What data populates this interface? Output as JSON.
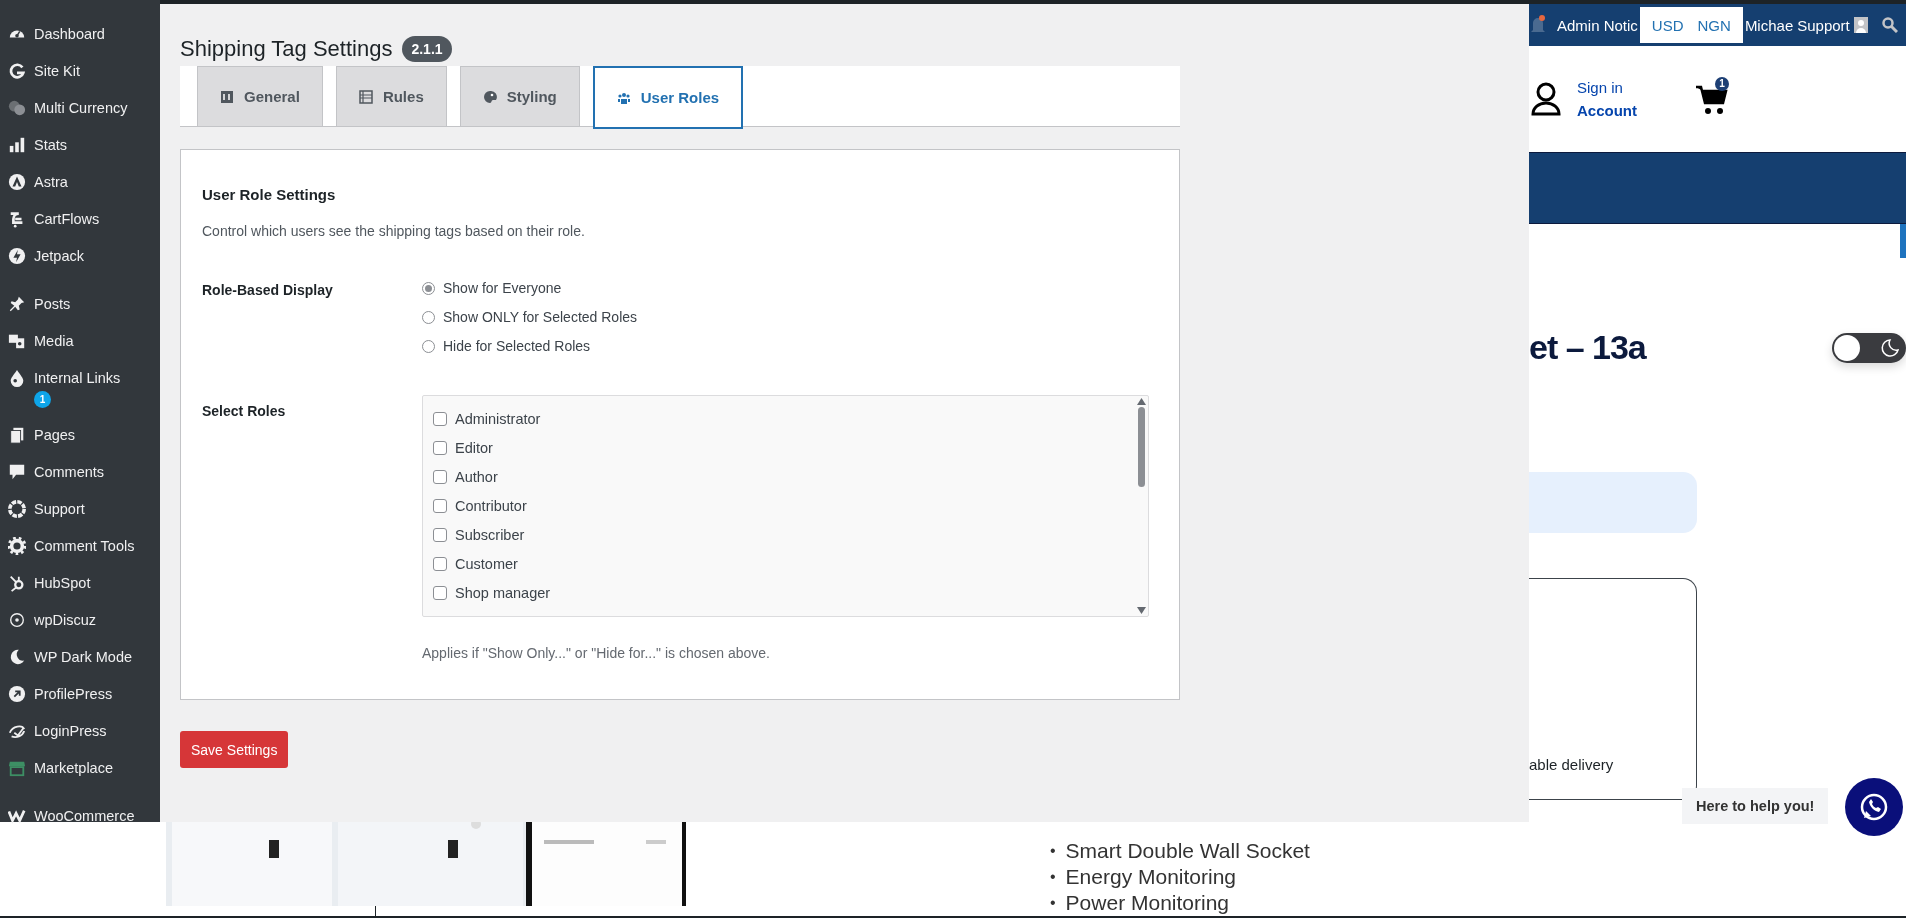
{
  "sidebar": {
    "groups": [
      [
        {
          "label": "Dashboard"
        },
        {
          "label": "Site Kit"
        },
        {
          "label": "Multi Currency"
        },
        {
          "label": "Stats"
        },
        {
          "label": "Astra"
        },
        {
          "label": "CartFlows"
        },
        {
          "label": "Jetpack"
        }
      ],
      [
        {
          "label": "Posts"
        },
        {
          "label": "Media"
        },
        {
          "label": "Internal Links",
          "badge": "1"
        },
        {
          "label": "Pages"
        },
        {
          "label": "Comments"
        },
        {
          "label": "Support"
        },
        {
          "label": "Comment Tools"
        },
        {
          "label": "HubSpot"
        },
        {
          "label": "wpDiscuz"
        },
        {
          "label": "WP Dark Mode"
        },
        {
          "label": "ProfilePress"
        },
        {
          "label": "LoginPress"
        },
        {
          "label": "Marketplace"
        }
      ],
      [
        {
          "label": "WooCommerce"
        }
      ]
    ]
  },
  "settings": {
    "title": "Shipping Tag Settings",
    "version": "2.1.1",
    "tabs": [
      {
        "label": "General",
        "selected": false
      },
      {
        "label": "Rules",
        "selected": false
      },
      {
        "label": "Styling",
        "selected": false
      },
      {
        "label": "User Roles",
        "selected": true
      }
    ],
    "section": {
      "title": "User Role Settings",
      "description": "Control which users see the shipping tags based on their role.",
      "role_display": {
        "label": "Role-Based Display",
        "options": [
          {
            "label": "Show for Everyone",
            "selected": true
          },
          {
            "label": "Show ONLY for Selected Roles",
            "selected": false
          },
          {
            "label": "Hide for Selected Roles",
            "selected": false
          }
        ]
      },
      "select_roles": {
        "label": "Select Roles",
        "roles": [
          {
            "label": "Administrator",
            "checked": false
          },
          {
            "label": "Editor",
            "checked": false
          },
          {
            "label": "Author",
            "checked": false
          },
          {
            "label": "Contributor",
            "checked": false
          },
          {
            "label": "Subscriber",
            "checked": false
          },
          {
            "label": "Customer",
            "checked": false
          },
          {
            "label": "Shop manager",
            "checked": false
          }
        ],
        "help": "Applies if \"Show Only...\" or \"Hide for...\" is chosen above."
      }
    },
    "save_button": "Save Settings"
  },
  "site": {
    "admin_bar": {
      "notices": "Admin Notic",
      "currencies": [
        "USD",
        "NGN"
      ],
      "user": "Michae",
      "support": "Support"
    },
    "account": {
      "sign_in": "Sign in",
      "account": "Account"
    },
    "cart_count": "1",
    "product_title": "et – 13a",
    "delivery_text": "able delivery",
    "dark_mode": {
      "on": false
    },
    "features": [
      {
        "bullet": "•",
        "text": "Smart Double Wall Socket"
      },
      {
        "bullet": "•",
        "text": "Energy Monitoring"
      },
      {
        "bullet": "•",
        "text": "Power Monitoring"
      }
    ],
    "chat": "Here to help you!"
  }
}
